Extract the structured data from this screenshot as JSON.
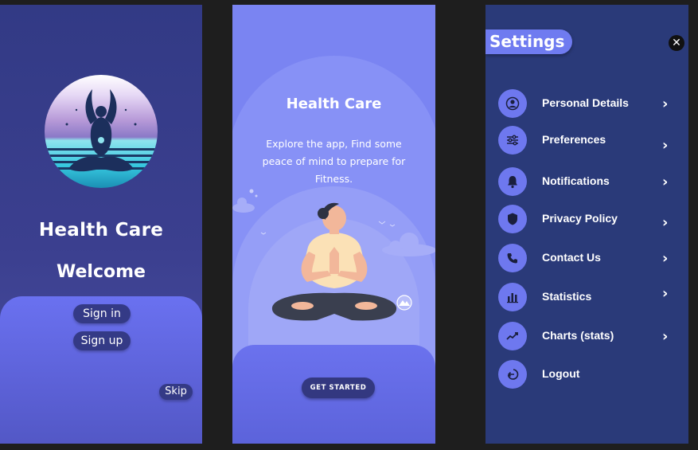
{
  "screen1": {
    "title": "Health Care",
    "welcome": "Welcome",
    "sign_in": "Sign in",
    "sign_up": "Sign up",
    "skip": "Skip"
  },
  "screen2": {
    "title": "Health Care",
    "description": "Explore the app, Find some peace of mind to prepare for Fitness.",
    "get_started": "GET STARTED"
  },
  "screen3": {
    "title": "Settings",
    "close_label": "✕",
    "items": [
      {
        "label": "Personal Details",
        "icon": "user-icon",
        "chevron": "›"
      },
      {
        "label": "Preferences",
        "icon": "sliders-icon",
        "chevron": "›"
      },
      {
        "label": "Notifications",
        "icon": "bell-icon",
        "chevron": "›"
      },
      {
        "label": "Privacy Policy",
        "icon": "shield-icon",
        "chevron": "›"
      },
      {
        "label": "Contact Us",
        "icon": "phone-icon",
        "chevron": "›"
      },
      {
        "label": "Statistics",
        "icon": "bar-chart-icon",
        "chevron": "›"
      },
      {
        "label": "Charts (stats)",
        "icon": "trend-icon",
        "chevron": "›"
      },
      {
        "label": "Logout",
        "icon": "logout-icon"
      }
    ]
  },
  "colors": {
    "accent": "#6e78ef",
    "dark_panel": "#2a3a79",
    "button_dark": "#343a86"
  }
}
